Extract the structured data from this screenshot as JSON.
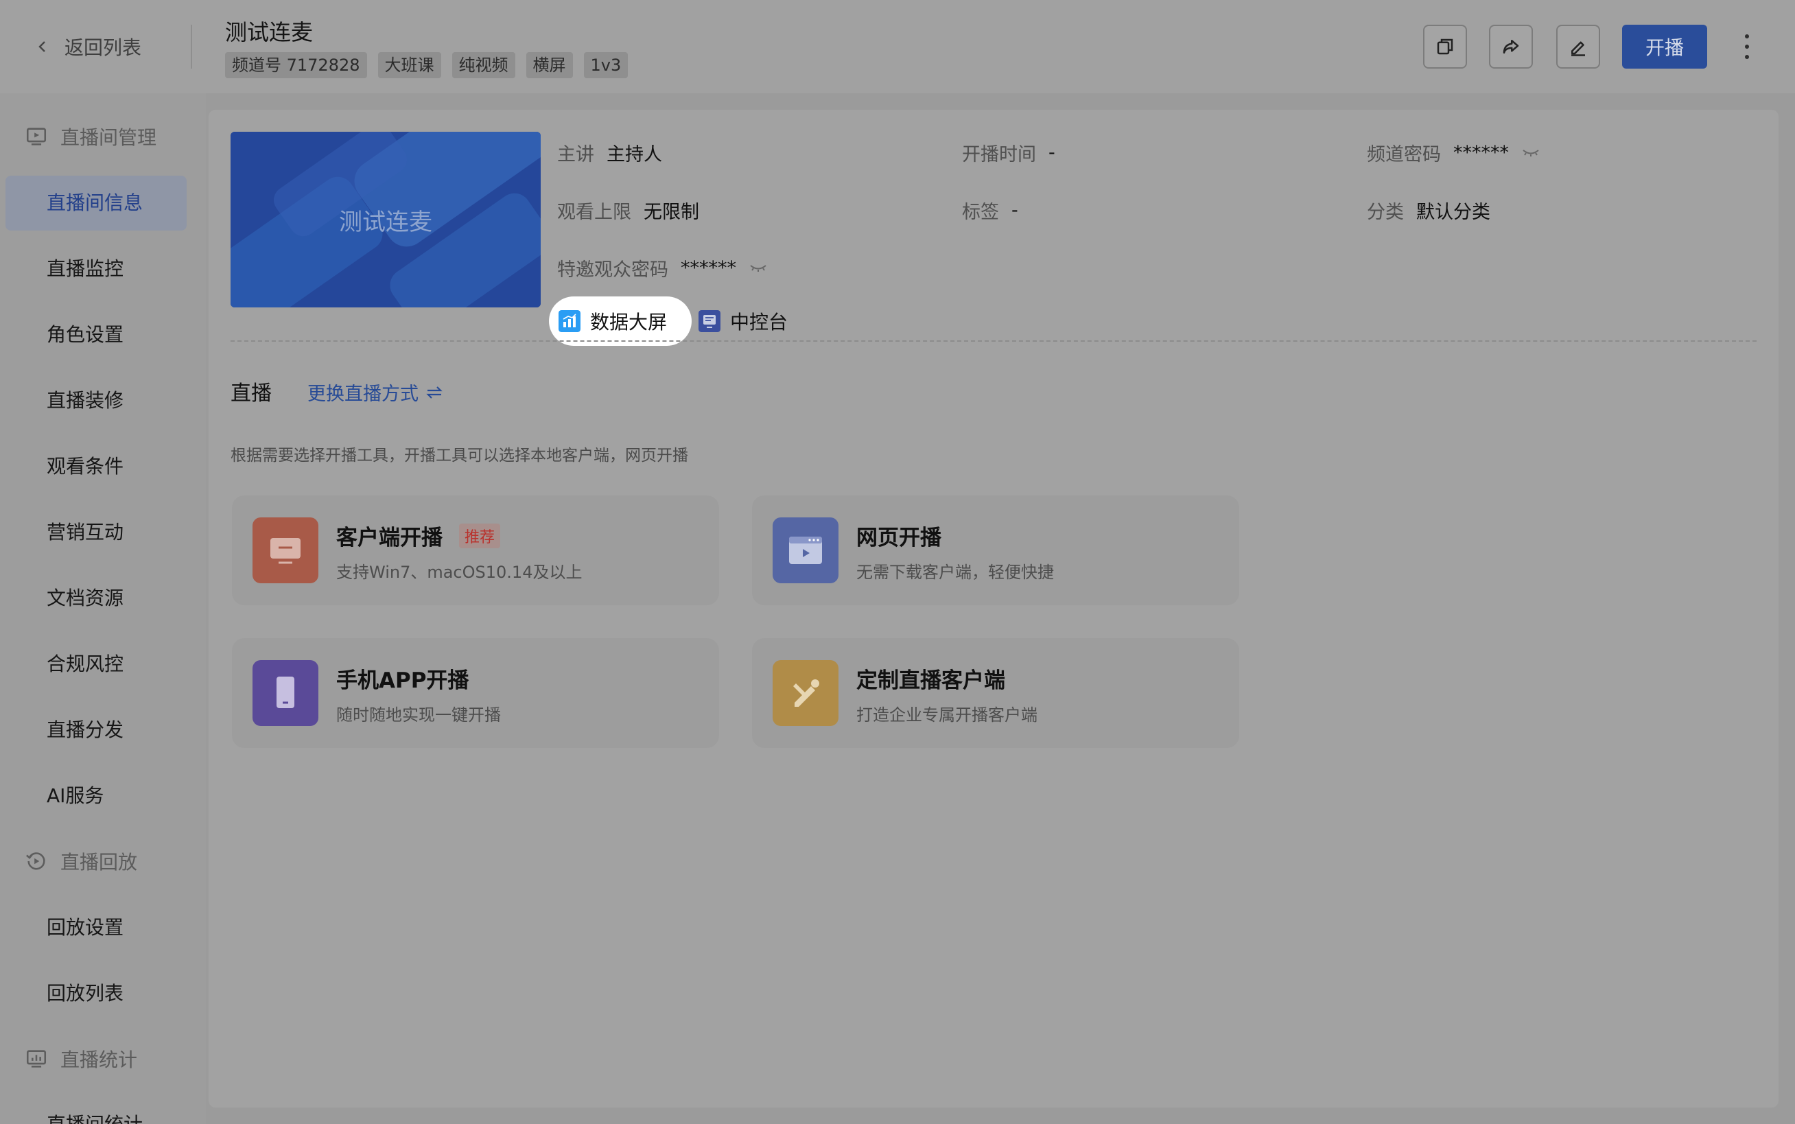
{
  "header": {
    "back_label": "返回列表",
    "title": "测试连麦",
    "tags": [
      "频道号 7172828",
      "大班课",
      "纯视频",
      "横屏",
      "1v3"
    ],
    "live_button": "开播"
  },
  "sidebar": {
    "groups": [
      {
        "label": "直播间管理"
      },
      {
        "label": "直播回放"
      },
      {
        "label": "直播统计"
      }
    ],
    "items": [
      "直播间信息",
      "直播监控",
      "角色设置",
      "直播装修",
      "观看条件",
      "营销互动",
      "文档资源",
      "合规风控",
      "直播分发",
      "AI服务",
      "回放设置",
      "回放列表",
      "直播间统计"
    ]
  },
  "room": {
    "cover_text": "测试连麦",
    "info": [
      {
        "key": "主讲",
        "value": "主持人"
      },
      {
        "key": "开播时间",
        "value": "-"
      },
      {
        "key": "频道密码",
        "value": "******"
      },
      {
        "key": "观看上限",
        "value": "无限制"
      },
      {
        "key": "标签",
        "value": "-"
      },
      {
        "key": "分类",
        "value": "默认分类"
      },
      {
        "key": "特邀观众密码",
        "value": "******"
      }
    ],
    "tools": [
      "数据大屏",
      "中控台"
    ]
  },
  "live": {
    "title": "直播",
    "switch_link": "更换直播方式",
    "description": "根据需要选择开播工具，开播工具可以选择本地客户端，网页开播",
    "cards": [
      {
        "title": "客户端开播",
        "badge": "推荐",
        "subtitle": "支持Win7、macOS10.14及以上",
        "color": "#a85a48"
      },
      {
        "title": "网页开播",
        "subtitle": "无需下载客户端，轻便快捷",
        "color": "#5566a4"
      },
      {
        "title": "手机APP开播",
        "subtitle": "随时随地实现一键开播",
        "color": "#5a4a98"
      },
      {
        "title": "定制直播客户端",
        "subtitle": "打造企业专属开播客户端",
        "color": "#b08c48"
      }
    ]
  },
  "colors": {
    "accent": "#2a4d9a",
    "badge": "#b9312c"
  }
}
